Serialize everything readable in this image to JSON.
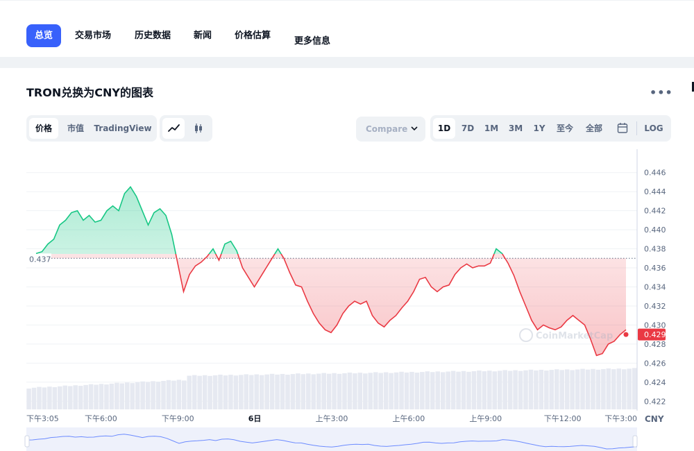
{
  "nav": {
    "tabs": [
      {
        "label": "总览",
        "active": true
      },
      {
        "label": "交易市场",
        "active": false
      },
      {
        "label": "历史数据",
        "active": false
      },
      {
        "label": "新闻",
        "active": false
      },
      {
        "label": "价格估算",
        "active": false
      },
      {
        "label": "更多信息",
        "active": false
      }
    ]
  },
  "card": {
    "title": "TRON兑换为CNY的图表",
    "more": "•••"
  },
  "toolbar": {
    "views": [
      "价格",
      "市值",
      "TradingView"
    ],
    "chart_type_icons": [
      "line-chart-icon",
      "candlestick-icon"
    ],
    "compare_label": "Compare with",
    "ranges": [
      "1D",
      "7D",
      "1M",
      "3M",
      "1Y",
      "至今",
      "全部"
    ],
    "calendar_icon": "calendar-icon",
    "log_label": "LOG"
  },
  "colors": {
    "accent": "#3861fb",
    "up": "#16c784",
    "down": "#ea3943",
    "text": "#0d1421",
    "muted": "#58667e"
  },
  "chart_data": {
    "type": "area",
    "reference_price": 0.437,
    "reference_label": "0.437",
    "current_price": 0.429,
    "current_label": "0.429",
    "currency": "CNY",
    "watermark": "CoinMarketCap",
    "ylim": [
      0.421,
      0.447
    ],
    "y_ticks": [
      "0.446",
      "0.444",
      "0.442",
      "0.440",
      "0.438",
      "0.436",
      "0.434",
      "0.432",
      "0.430",
      "0.428",
      "0.426",
      "0.424",
      "0.422"
    ],
    "x_ticks": [
      {
        "label": "下午3:05",
        "t": 0.0,
        "bold": false
      },
      {
        "label": "下午6:00",
        "t": 0.122,
        "bold": false
      },
      {
        "label": "下午9:00",
        "t": 0.248,
        "bold": false
      },
      {
        "label": "6日",
        "t": 0.374,
        "bold": true
      },
      {
        "label": "上午3:00",
        "t": 0.5,
        "bold": false
      },
      {
        "label": "上午6:00",
        "t": 0.626,
        "bold": false
      },
      {
        "label": "上午9:00",
        "t": 0.752,
        "bold": false
      },
      {
        "label": "下午12:00",
        "t": 0.878,
        "bold": false
      },
      {
        "label": "下午3:00",
        "t": 1.0,
        "bold": false
      }
    ],
    "series": [
      {
        "values": [
          0.4375,
          0.4377,
          0.4385,
          0.439,
          0.4405,
          0.441,
          0.4418,
          0.442,
          0.441,
          0.4415,
          0.4408,
          0.441,
          0.442,
          0.4425,
          0.442,
          0.4438,
          0.4445,
          0.4435,
          0.442,
          0.4405,
          0.4418,
          0.4422,
          0.4415,
          0.4395,
          0.4365,
          0.4335,
          0.4353,
          0.4362,
          0.4366,
          0.4372,
          0.438,
          0.4368,
          0.4385,
          0.4388,
          0.4378,
          0.436,
          0.435,
          0.434,
          0.435,
          0.436,
          0.437,
          0.438,
          0.437,
          0.4355,
          0.4342,
          0.434,
          0.4325,
          0.4312,
          0.4302,
          0.4295,
          0.4292,
          0.43,
          0.4312,
          0.432,
          0.4325,
          0.4322,
          0.4325,
          0.431,
          0.4302,
          0.4298,
          0.4305,
          0.431,
          0.4318,
          0.4325,
          0.4335,
          0.4348,
          0.435,
          0.434,
          0.4335,
          0.434,
          0.4342,
          0.4353,
          0.436,
          0.4364,
          0.436,
          0.4362,
          0.4362,
          0.4365,
          0.438,
          0.4375,
          0.4365,
          0.4352,
          0.4335,
          0.432,
          0.4305,
          0.4295,
          0.43,
          0.4297,
          0.4295,
          0.4298,
          0.4305,
          0.431,
          0.4305,
          0.43,
          0.4285,
          0.4268,
          0.427,
          0.428,
          0.4283,
          0.429,
          0.4295
        ]
      }
    ],
    "volume_bars_count": 118
  }
}
